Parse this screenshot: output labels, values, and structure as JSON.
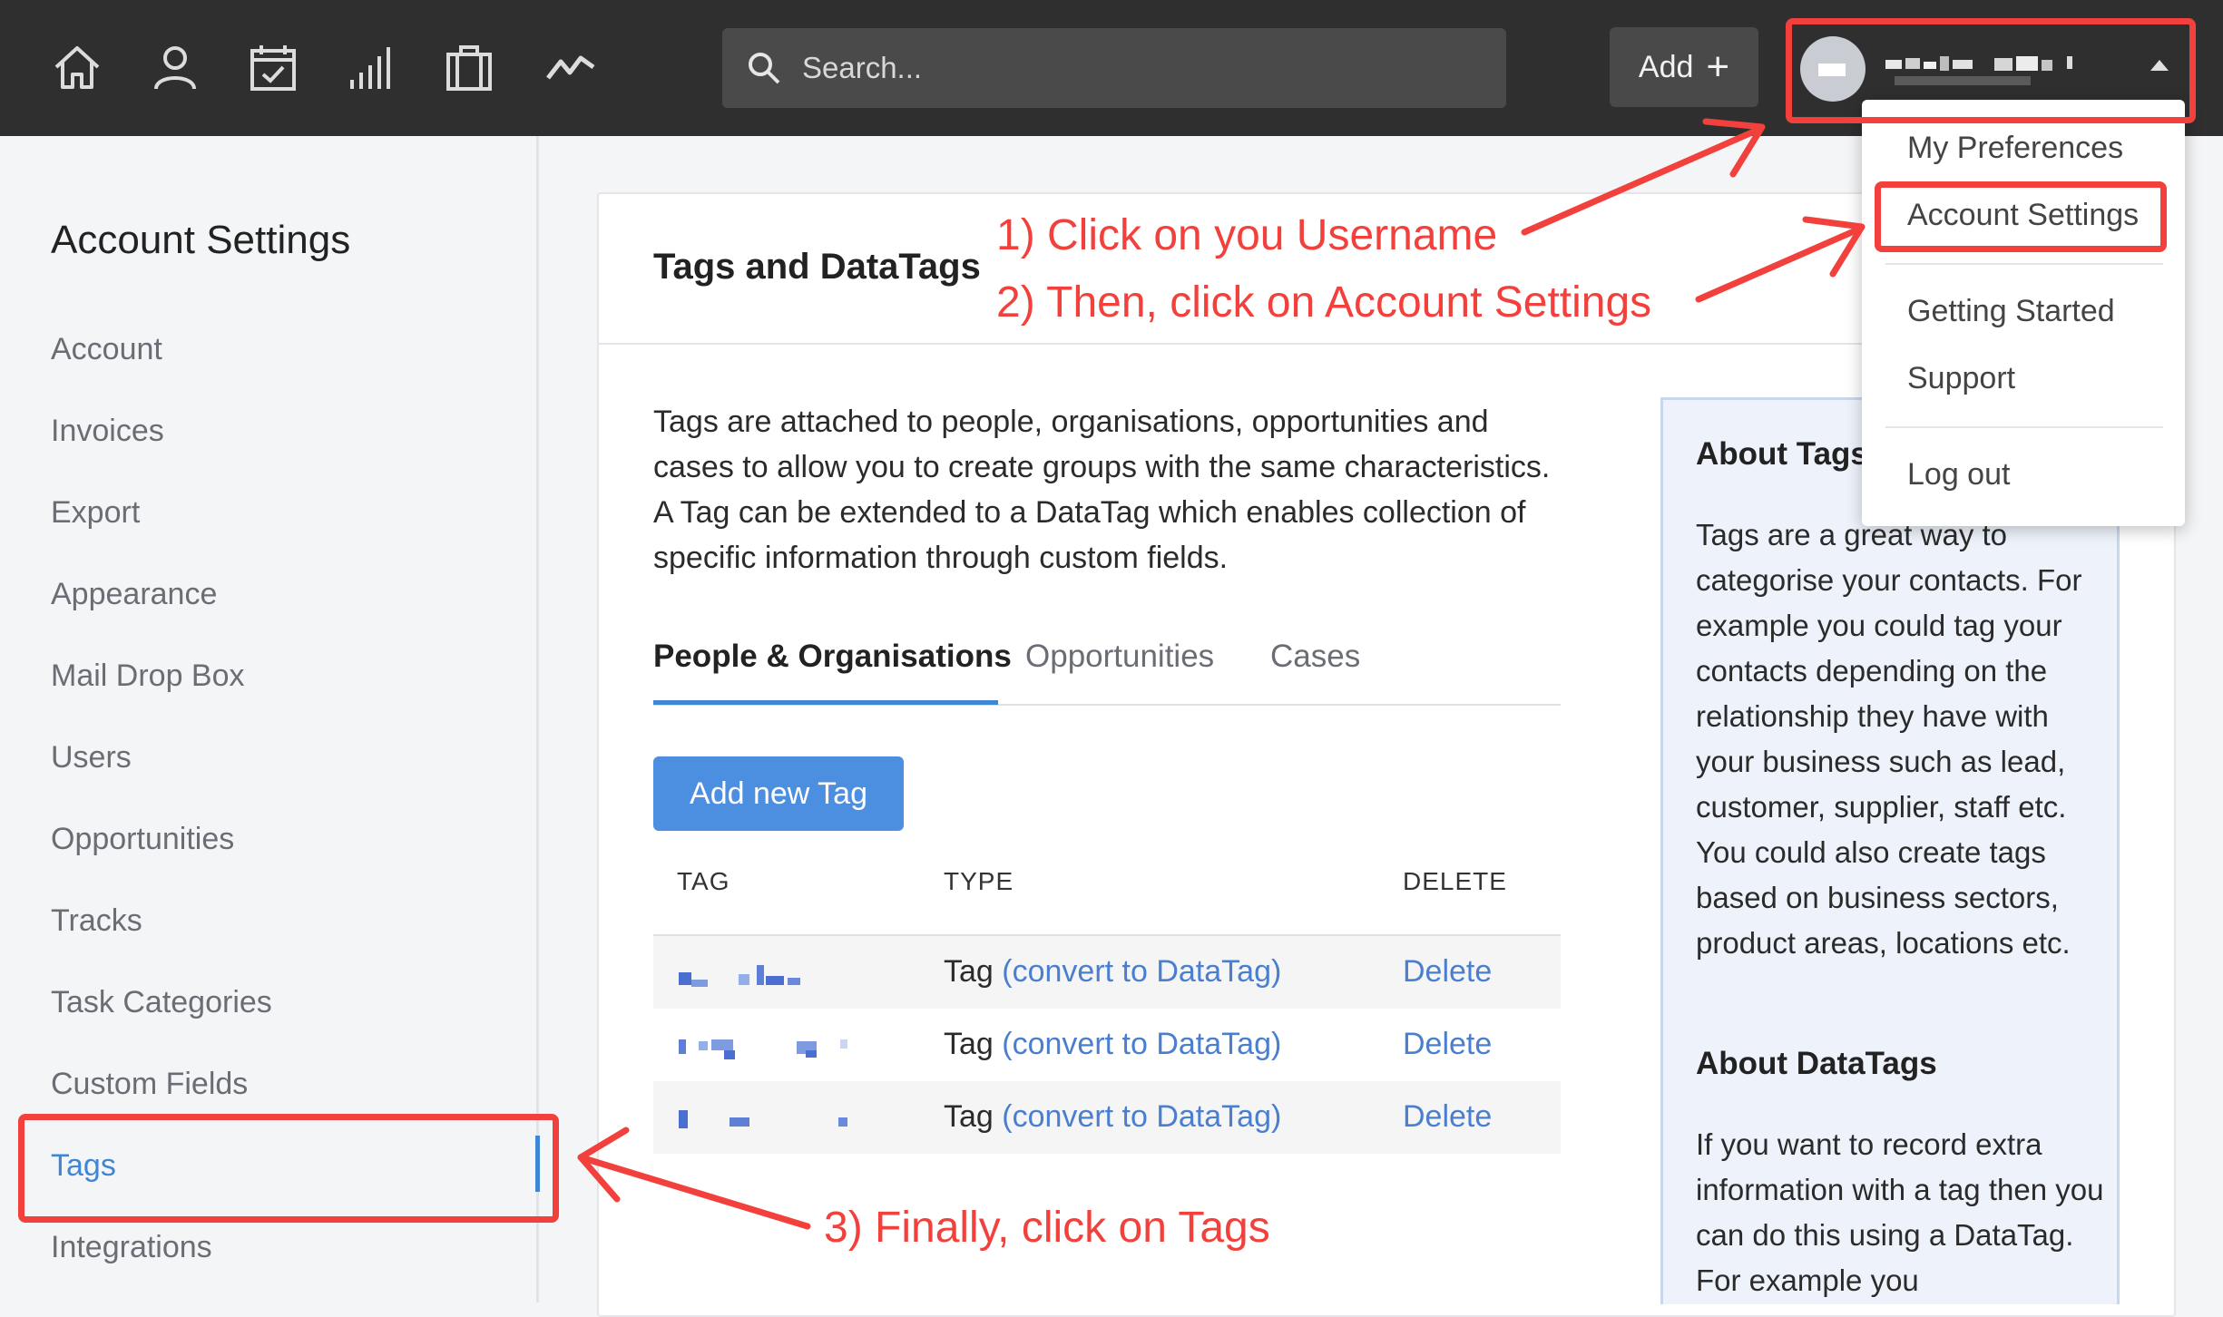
{
  "topbar": {
    "icons": [
      "home-icon",
      "person-icon",
      "calendar-check-icon",
      "bar-chart-icon",
      "briefcase-icon",
      "activity-icon"
    ],
    "search_placeholder": "Search...",
    "add_label": "Add",
    "add_symbol": "+"
  },
  "user_menu": {
    "items": [
      "My Preferences",
      "Account Settings",
      "Getting Started",
      "Support",
      "Log out"
    ]
  },
  "sidebar": {
    "title": "Account Settings",
    "items": [
      "Account",
      "Invoices",
      "Export",
      "Appearance",
      "Mail Drop Box",
      "Users",
      "Opportunities",
      "Tracks",
      "Task Categories",
      "Custom Fields",
      "Tags",
      "Integrations"
    ],
    "active": "Tags"
  },
  "main": {
    "title": "Tags and DataTags",
    "intro": "Tags are attached to people, organisations, opportunities and cases to allow you to create groups with the same characteristics. A Tag can be extended to a DataTag which enables collection of specific information through custom fields.",
    "tabs": [
      "People & Organisations",
      "Opportunities",
      "Cases"
    ],
    "active_tab": "People & Organisations",
    "add_button": "Add new Tag",
    "table": {
      "headers": [
        "TAG",
        "TYPE",
        "DELETE"
      ],
      "rows": [
        {
          "type": "Tag",
          "convert": "(convert to DataTag)",
          "delete": "Delete"
        },
        {
          "type": "Tag",
          "convert": "(convert to DataTag)",
          "delete": "Delete"
        },
        {
          "type": "Tag",
          "convert": "(convert to DataTag)",
          "delete": "Delete"
        }
      ]
    }
  },
  "aside": {
    "about_tags_title": "About Tags",
    "about_tags_text": "Tags are a great way to categorise your contacts. For example you could tag your contacts depending on the relationship they have with your business such as lead, customer, supplier, staff etc. You could also create tags based on business sectors, product areas, locations etc.",
    "about_datatags_title": "About DataTags",
    "about_datatags_text": "If you want to record extra information with a tag then you can do this using a DataTag. For example you"
  },
  "annotations": {
    "step1": "1) Click on you Username",
    "step2": "2) Then, click on Account Settings",
    "step3": "3) Finally, click on Tags",
    "color": "#f2413c"
  },
  "colors": {
    "topbar": "#2f2f2f",
    "accent": "#3f86d4",
    "primary_button": "#4c8fe0",
    "link": "#4a7fd0"
  }
}
